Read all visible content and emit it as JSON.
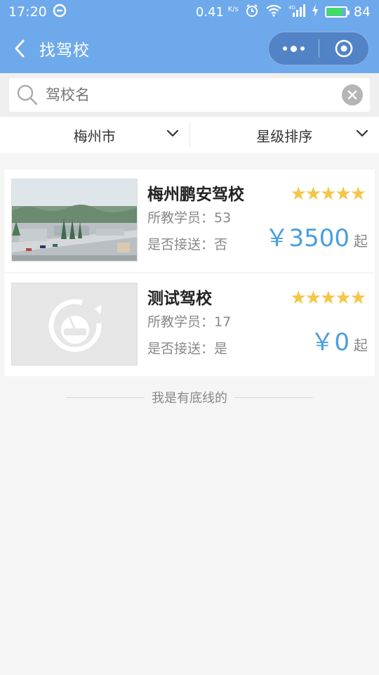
{
  "status_bar": {
    "time": "17:20",
    "speed": "0.41",
    "speed_unit": "K/s",
    "network": "4G",
    "battery": "84"
  },
  "header": {
    "title": "找驾校"
  },
  "search": {
    "placeholder": "驾校名",
    "value": ""
  },
  "filters": {
    "city": "梅州市",
    "sort": "星级排序"
  },
  "schools": [
    {
      "name": "梅州鹏安驾校",
      "students_label": "所教学员：",
      "students": "53",
      "pickup_label": "是否接送：",
      "pickup": "否",
      "stars": "★★★★★",
      "currency": "￥",
      "price": "3500",
      "price_unit": "起"
    },
    {
      "name": "测试驾校",
      "students_label": "所教学员：",
      "students": "17",
      "pickup_label": "是否接送：",
      "pickup": "是",
      "stars": "★★★★★",
      "currency": "￥",
      "price": "0",
      "price_unit": "起"
    }
  ],
  "footer": {
    "text": "我是有底线的"
  },
  "colors": {
    "header_bg": "#6ea9ec",
    "price": "#4a9ede",
    "star": "#f5c545"
  }
}
